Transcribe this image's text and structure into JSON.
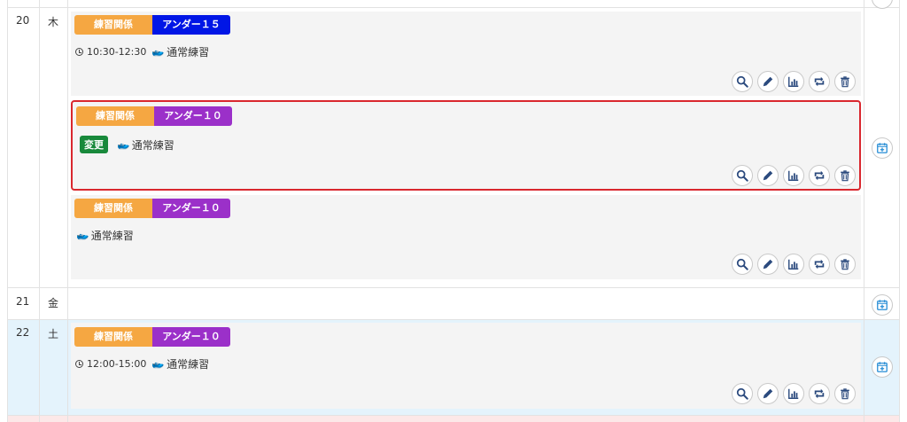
{
  "rows": [
    {
      "date": "20",
      "weekday": "木",
      "events": [
        {
          "category": "練習関係",
          "group": "アンダー１５",
          "group_color": "#0016e6",
          "time": "10:30-12:30",
          "type": "通常練習",
          "badge": ""
        },
        {
          "category": "練習関係",
          "group": "アンダー１０",
          "group_color": "#9b30c9",
          "time": "",
          "type": "通常練習",
          "badge": "変更"
        },
        {
          "category": "練習関係",
          "group": "アンダー１０",
          "group_color": "#9b30c9",
          "time": "",
          "type": "通常練習",
          "badge": ""
        }
      ]
    },
    {
      "date": "21",
      "weekday": "金",
      "events": []
    },
    {
      "date": "22",
      "weekday": "土",
      "events": [
        {
          "category": "練習関係",
          "group": "アンダー１０",
          "group_color": "#9b30c9",
          "time": "12:00-15:00",
          "type": "通常練習",
          "badge": ""
        }
      ]
    }
  ],
  "icons": {
    "search": "search-icon",
    "edit": "pencil-icon",
    "stats": "bar-chart-icon",
    "repeat": "repeat-icon",
    "delete": "trash-icon",
    "add": "calendar-plus-icon"
  },
  "colors": {
    "category_tag": "#f5a742",
    "selected_border": "#d9272e",
    "badge_change": "#18893b",
    "saturday_row": "#e4f3fc",
    "icon": "#2b4a7e"
  }
}
